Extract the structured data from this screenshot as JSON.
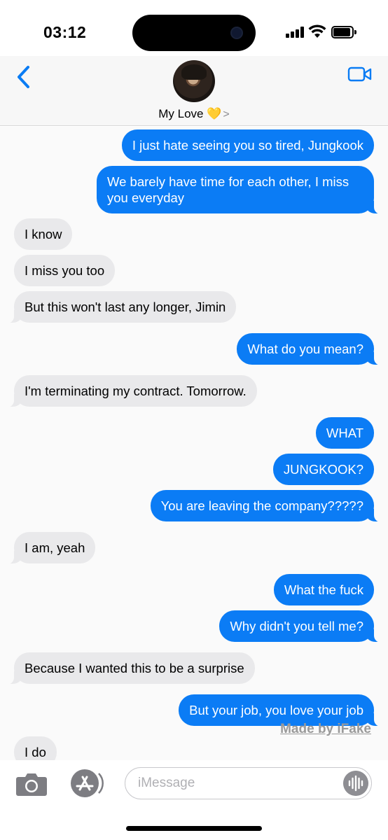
{
  "status_bar": {
    "time": "03:12"
  },
  "header": {
    "contact_name": "My Love 💛",
    "chevron": ">"
  },
  "messages": [
    {
      "from": "me",
      "text": "I just hate seeing you so tired, Jungkook"
    },
    {
      "from": "me",
      "text": "We barely have time for each other, I miss you everyday"
    },
    {
      "from": "them",
      "text": "I know"
    },
    {
      "from": "them",
      "text": "I miss you too"
    },
    {
      "from": "them",
      "text": "But this won't last any longer, Jimin"
    },
    {
      "from": "me",
      "text": "What do you mean?"
    },
    {
      "from": "them",
      "text": "I'm terminating my contract. Tomorrow."
    },
    {
      "from": "me",
      "text": "WHAT"
    },
    {
      "from": "me",
      "text": "JUNGKOOK?"
    },
    {
      "from": "me",
      "text": "You are leaving the company?????"
    },
    {
      "from": "them",
      "text": "I am, yeah"
    },
    {
      "from": "me",
      "text": "What the fuck"
    },
    {
      "from": "me",
      "text": "Why didn't you tell me?"
    },
    {
      "from": "them",
      "text": "Because I wanted this to be a surprise"
    },
    {
      "from": "me",
      "text": "But your job, you love your job"
    },
    {
      "from": "them",
      "text": "I do"
    }
  ],
  "watermark": "Made by iFake",
  "input_bar": {
    "placeholder": "iMessage"
  },
  "colors": {
    "sent_bubble": "#0b7cf5",
    "received_bubble": "#e9e9eb",
    "accent": "#0a7cf4"
  }
}
